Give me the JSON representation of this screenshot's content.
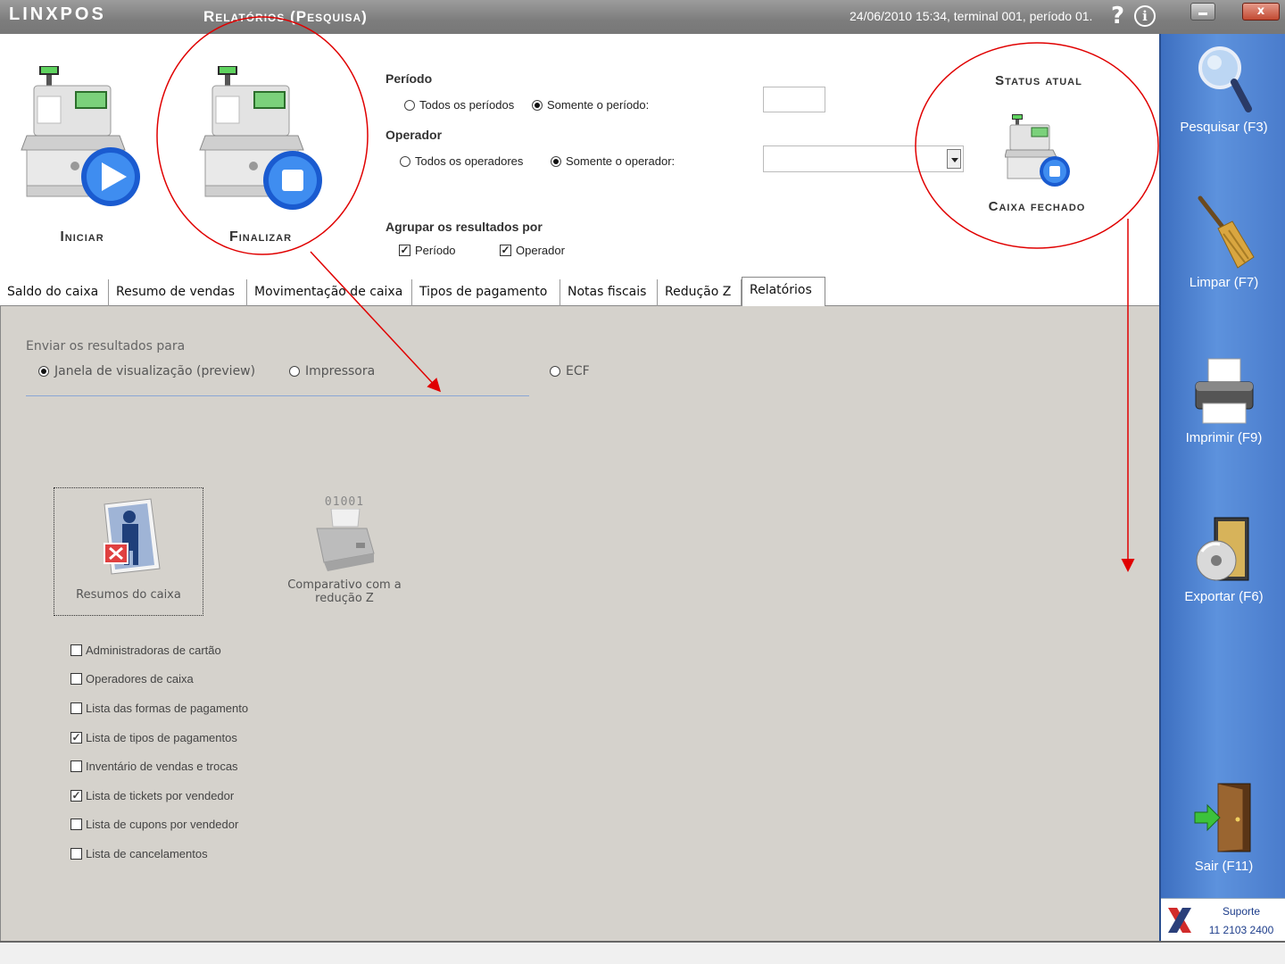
{
  "titlebar": {
    "app_logo": "LINXPOS",
    "window_title": "Relatórios (Pesquisa)",
    "status": "24/06/2010 15:34, terminal 001, período 01.",
    "help_label": "?",
    "info_label": "i",
    "close_label": "x"
  },
  "actions": {
    "start_label": "Iniciar",
    "finish_label": "Finalizar"
  },
  "filters": {
    "period_label": "Período",
    "period_all": "Todos os períodos",
    "period_only": "Somente o período:",
    "operator_label": "Operador",
    "operator_all": "Todos os operadores",
    "operator_only": "Somente o operador:",
    "group_label": "Agrupar os resultados por",
    "group_period": "Período",
    "group_operator": "Operador"
  },
  "status": {
    "title": "Status atual",
    "value": "Caixa fechado"
  },
  "tabs": [
    "Saldo do caixa",
    "Resumo de vendas",
    "Movimentação de caixa",
    "Tipos de pagamento",
    "Notas fiscais",
    "Redução Z",
    "Relatórios"
  ],
  "output": {
    "label": "Enviar os resultados para",
    "preview": "Janela de visualização (preview)",
    "printer": "Impressora",
    "ecf": "ECF"
  },
  "reports": {
    "cash_summary": "Resumos do caixa",
    "compare_line1": "Comparativo com a",
    "compare_line2": "redução Z",
    "compare_code": "01001"
  },
  "options": [
    {
      "label": "Administradoras de cartão",
      "checked": false
    },
    {
      "label": "Operadores de caixa",
      "checked": false
    },
    {
      "label": "Lista das formas de pagamento",
      "checked": false
    },
    {
      "label": "Lista de tipos de pagamentos",
      "checked": true
    },
    {
      "label": "Inventário de vendas e trocas",
      "checked": false
    },
    {
      "label": "Lista de tickets por vendedor",
      "checked": true
    },
    {
      "label": "Lista de cupons por vendedor",
      "checked": false
    },
    {
      "label": "Lista de cancelamentos",
      "checked": false
    }
  ],
  "sidebar": {
    "search": "Pesquisar (F3)",
    "clear": "Limpar (F7)",
    "print": "Imprimir (F9)",
    "export": "Exportar (F6)",
    "exit": "Sair (F11)",
    "support_label": "Suporte",
    "support_phone": "11 2103 2400"
  },
  "colors": {
    "sidebar": "#4f86d6",
    "content_bg": "#d5d2cc",
    "annotation": "#e00000"
  }
}
